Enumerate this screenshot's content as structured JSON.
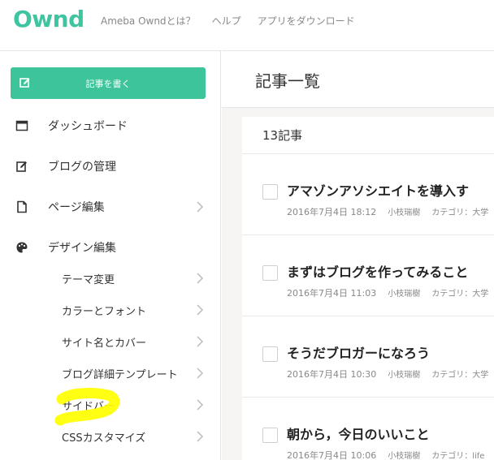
{
  "header": {
    "logo": "Ownd",
    "nav": [
      "Ameba Owndとは？",
      "ヘルプ",
      "アプリをダウンロード"
    ]
  },
  "sidebar": {
    "write_button": "記事を書く",
    "items": [
      {
        "label": "ダッシュボード",
        "icon": "calendar-icon"
      },
      {
        "label": "ブログの管理",
        "icon": "edit-icon"
      },
      {
        "label": "ページ編集",
        "icon": "page-icon"
      },
      {
        "label": "デザイン編集",
        "icon": "palette-icon"
      }
    ],
    "sub_items": [
      "テーマ変更",
      "カラーとフォント",
      "サイト名とカバー",
      "ブログ詳細テンプレート",
      "サイドバー",
      "CSSカスタマイズ"
    ]
  },
  "main": {
    "title": "記事一覧",
    "count": "13記事",
    "posts": [
      {
        "title": "アマゾンアソシエイトを導入す",
        "date": "2016年7月4日 18:12",
        "author": "小枝瑞樹",
        "category": "カテゴリ：大学"
      },
      {
        "title": "まずはブログを作ってみること",
        "date": "2016年7月4日 11:03",
        "author": "小枝瑞樹",
        "category": "カテゴリ：大学"
      },
      {
        "title": "そうだブロガーになろう",
        "date": "2016年7月4日 10:30",
        "author": "小枝瑞樹",
        "category": "カテゴリ：大学"
      },
      {
        "title": "朝から，今日のいいこと",
        "date": "2016年7月4日 10:06",
        "author": "小枝瑞樹",
        "category": "カテゴリ：life"
      }
    ]
  },
  "colors": {
    "accent": "#3ec49a",
    "highlight": "#ffff00"
  }
}
